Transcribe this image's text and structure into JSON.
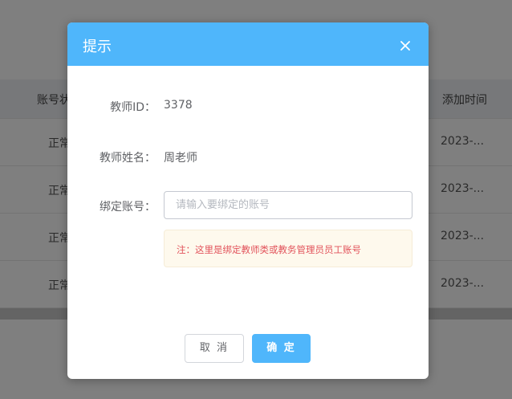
{
  "background_table": {
    "headers": [
      "账号状",
      "添加时间"
    ],
    "rows": [
      {
        "status": "正常",
        "time": "2023-..."
      },
      {
        "status": "正常",
        "time": "2023-..."
      },
      {
        "status": "正常",
        "time": "2023-..."
      },
      {
        "status": "正常",
        "time": "2023-..."
      }
    ]
  },
  "dialog": {
    "title": "提示",
    "close_icon": "close-icon",
    "fields": {
      "teacher_id": {
        "label": "教师ID：",
        "value": "3378"
      },
      "teacher_name": {
        "label": "教师姓名：",
        "value": "周老师"
      },
      "bind_account": {
        "label": "绑定账号：",
        "value": "",
        "placeholder": "请输入要绑定的账号"
      }
    },
    "notice": "注：这里是绑定教师类或教务管理员员工账号",
    "buttons": {
      "cancel": "取 消",
      "confirm": "确 定"
    }
  },
  "colors": {
    "header_bg": "#4fb6fb",
    "confirm_bg": "#4fb6fb",
    "notice_bg": "#fef9ed",
    "notice_text": "#e2535b"
  }
}
